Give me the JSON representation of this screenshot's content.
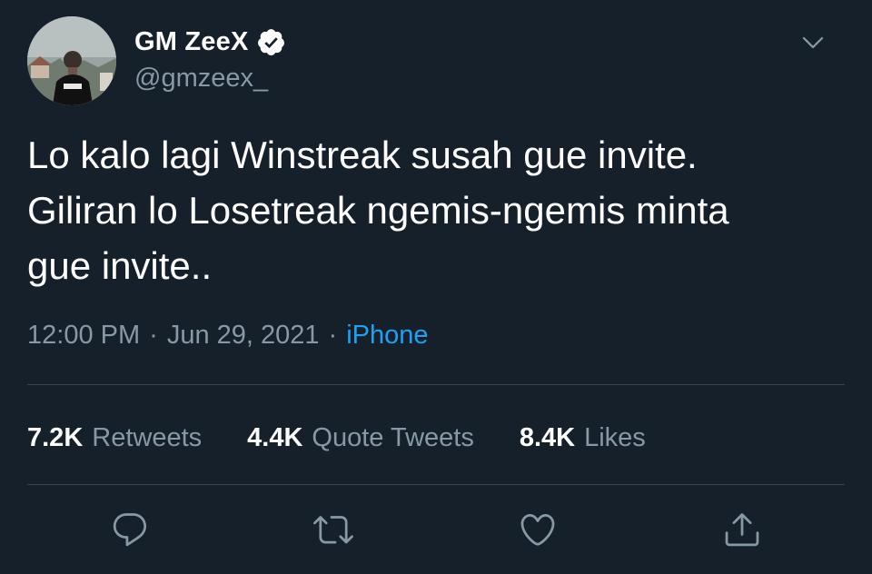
{
  "user": {
    "display_name": "GM ZeeX",
    "handle": "@gmzeex_",
    "verified": true,
    "avatar_icon": "profile-photo"
  },
  "tweet": {
    "text": "Lo kalo lagi Winstreak susah gue invite.\nGiliran lo Losetreak ngemis-ngemis minta\ngue invite..",
    "time": "12:00 PM",
    "date": "Jun 29, 2021",
    "separator": "·",
    "source": "iPhone"
  },
  "stats": {
    "retweets": {
      "count": "7.2K",
      "label": "Retweets"
    },
    "quotes": {
      "count": "4.4K",
      "label": "Quote Tweets"
    },
    "likes": {
      "count": "8.4K",
      "label": "Likes"
    }
  },
  "icons": {
    "verified": "verified-badge-icon",
    "caret": "chevron-down-icon",
    "reply": "reply-icon",
    "retweet": "retweet-icon",
    "like": "heart-icon",
    "share": "share-icon"
  },
  "colors": {
    "background": "#15202b",
    "text_primary": "#ffffff",
    "text_secondary": "#8899a6",
    "accent": "#1da1f2",
    "divider": "#38444d"
  }
}
